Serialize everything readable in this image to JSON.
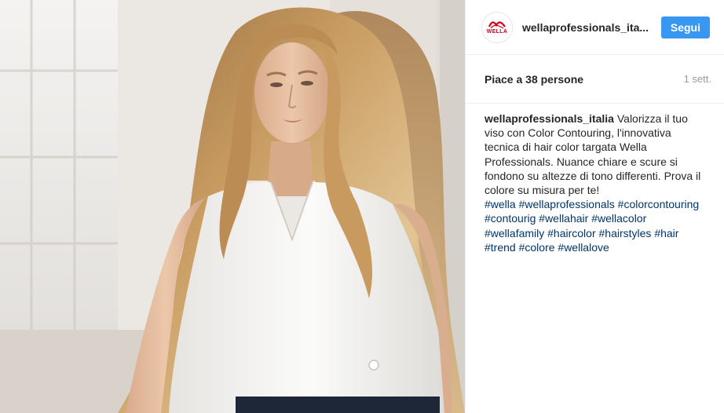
{
  "post": {
    "image_alt": "Woman with long wavy blonde hair wearing a white sleeveless top",
    "colors": {
      "hair": "#c79a5e",
      "skin": "#e8c3a6",
      "top": "#f6f5f3",
      "background": "#ece9e5"
    }
  },
  "header": {
    "avatar_logo_text": "WELLA",
    "avatar_icon": "wella-logo-icon",
    "username": "wellaprofessionals_ita...",
    "follow_label": "Segui",
    "follow_color": "#3897f0"
  },
  "meta": {
    "likes_text": "Piace a 38 persone",
    "time_text": "1 sett."
  },
  "caption": {
    "username": "wellaprofessionals_italia",
    "text": " Valorizza il tuo viso con Color Contouring, l'innovativa tecnica di hair color targata Wella Professionals. Nuance chiare e scure si fondono su altezze di tono differenti. Prova il colore su misura per te!",
    "hashtags": [
      "#wella",
      "#wellaprofessionals",
      "#colorcontouring",
      "#contourig",
      "#wellahair",
      "#wellacolor",
      "#wellafamily",
      "#haircolor",
      "#hairstyles",
      "#hair",
      "#trend",
      "#colore",
      "#wellalove"
    ],
    "hashtag_color": "#003569"
  }
}
